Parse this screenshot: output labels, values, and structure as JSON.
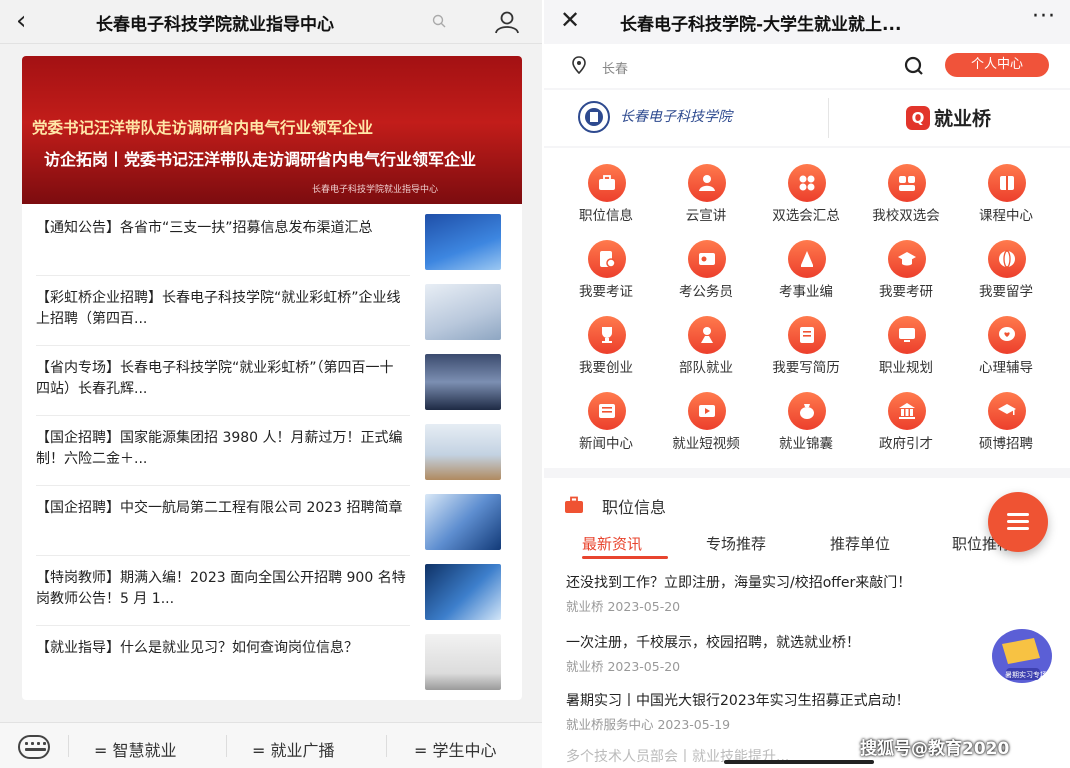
{
  "left": {
    "back_glyph": "‹",
    "title": "长春电子科技学院就业指导中心",
    "banner": {
      "line1": "党委书记汪洋带队走访调研省内电气行业领军企业",
      "line2": "访企拓岗丨党委书记汪洋带队走访调研省内电气行业领军企业",
      "source": "长春电子科技学院就业指导中心"
    },
    "news": [
      {
        "text": "【通知公告】各省市“三支一扶”招募信息发布渠道汇总"
      },
      {
        "text": "【彩虹桥企业招聘】长春电子科技学院“就业彩虹桥”企业线上招聘（第四百..."
      },
      {
        "text": "【省内专场】长春电子科技学院“就业彩虹桥”（第四百一十四站）长春孔辉..."
      },
      {
        "text": "【国企招聘】国家能源集团招 3980 人！月薪过万！正式编制！六险二金＋..."
      },
      {
        "text": "【国企招聘】中交一航局第二工程有限公司 2023 招聘简章"
      },
      {
        "text": "【特岗教师】期满入编！2023 面向全国公开招聘 900 名特岗教师公告！5 月 1..."
      },
      {
        "text": "【就业指导】什么是就业见习？如何查询岗位信息？"
      }
    ],
    "bottom_nav": [
      "智慧就业",
      "就业广播",
      "学生中心"
    ],
    "nav_prefix": "="
  },
  "right": {
    "close_glyph": "✕",
    "title": "长春电子科技学院-大学生就业就上...",
    "more_glyph": "···",
    "city": "长春",
    "personal_center": "个人中心",
    "logo_school": "长春电子科技学院",
    "logo_brand": "就业桥",
    "logo_brand_mark": "Q",
    "grid": [
      {
        "label": "职位信息",
        "icon": "briefcase-icon"
      },
      {
        "label": "云宣讲",
        "icon": "presenter-icon"
      },
      {
        "label": "双选会汇总",
        "icon": "grid-icon"
      },
      {
        "label": "我校双选会",
        "icon": "people-icon"
      },
      {
        "label": "课程中心",
        "icon": "book-icon"
      },
      {
        "label": "我要考证",
        "icon": "certificate-icon"
      },
      {
        "label": "考公务员",
        "icon": "id-card-icon"
      },
      {
        "label": "考事业编",
        "icon": "scales-icon"
      },
      {
        "label": "我要考研",
        "icon": "graduation-cap-icon"
      },
      {
        "label": "我要留学",
        "icon": "globe-icon"
      },
      {
        "label": "我要创业",
        "icon": "trophy-icon"
      },
      {
        "label": "部队就业",
        "icon": "soldier-icon"
      },
      {
        "label": "我要写简历",
        "icon": "resume-icon"
      },
      {
        "label": "职业规划",
        "icon": "monitor-icon"
      },
      {
        "label": "心理辅导",
        "icon": "heart-chat-icon"
      },
      {
        "label": "新闻中心",
        "icon": "newspaper-icon"
      },
      {
        "label": "就业短视频",
        "icon": "video-icon"
      },
      {
        "label": "就业锦囊",
        "icon": "bag-icon"
      },
      {
        "label": "政府引才",
        "icon": "government-icon"
      },
      {
        "label": "硕博招聘",
        "icon": "doctor-cap-icon"
      }
    ],
    "section_title": "职位信息",
    "tabs": [
      "最新资讯",
      "专场推荐",
      "推荐单位",
      "职位推荐"
    ],
    "items": [
      {
        "title": "还没找到工作？立即注册，海量实习/校招offer来敲门！",
        "meta": "就业桥 2023-05-20"
      },
      {
        "title": "一次注册，千校展示，校园招聘，就选就业桥！",
        "meta": "就业桥 2023-05-20"
      },
      {
        "title": "暑期实习丨中国光大银行2023年实习生招募正式启动！",
        "meta": "就业桥服务中心 2023-05-19"
      },
      {
        "title": "多个技术人员部会丨就业技能提升...",
        "meta": ""
      }
    ],
    "badge_text": "暑期实习专场"
  },
  "watermark": "搜狐号@教育2020",
  "colors": {
    "accent": "#e8442e",
    "banner": "#b0161a",
    "brand_blue": "#2e4a8f"
  }
}
